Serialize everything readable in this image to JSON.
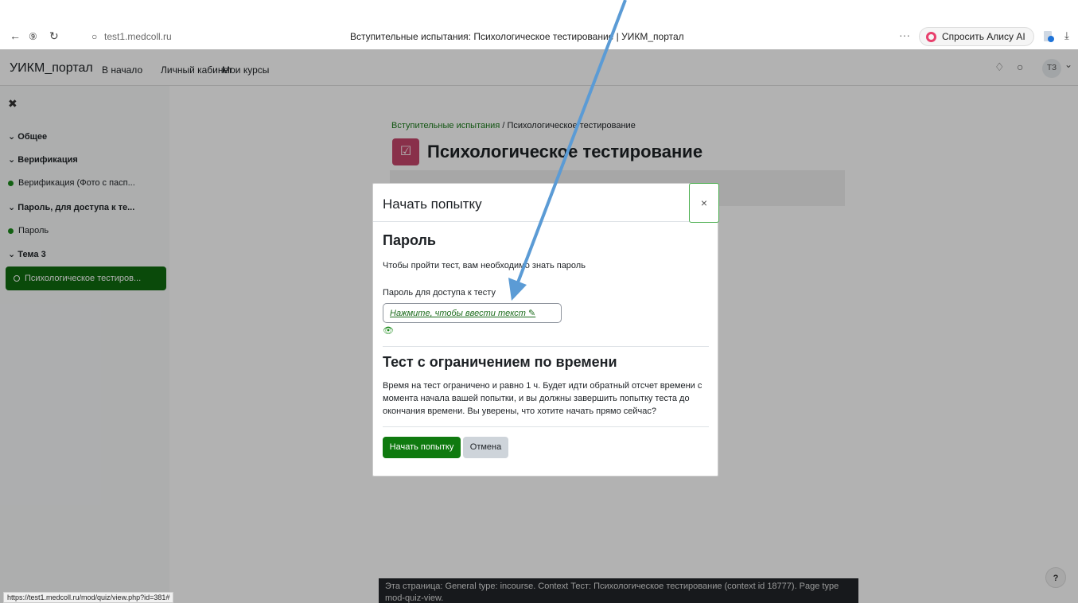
{
  "browser": {
    "back_icon": "←",
    "yandex_icon": "⑨",
    "reload_icon": "↻",
    "shield_icon": "○",
    "url": "test1.medcoll.ru",
    "tab_title": "Вступительные испытания: Психологическое тестирование | УИКМ_портал",
    "more_icon": "···",
    "alice_label": "Спросить Алису AI",
    "download_icon": "⤓"
  },
  "navbar": {
    "brand": "УИКМ_портал",
    "links": [
      "В начало",
      "Личный кабинет",
      "Мои курсы"
    ],
    "bell_icon": "♢",
    "chat_icon": "○",
    "avatar_initials": "ТЗ",
    "avatar_chevron": "⌄"
  },
  "sidebar": {
    "close_icon": "✖",
    "sections": [
      {
        "label": "Общее"
      },
      {
        "label": "Верификация"
      },
      {
        "label": "Верификация (Фото с пасп..."
      },
      {
        "label": "Пароль, для доступа к те..."
      },
      {
        "label": "Пароль"
      },
      {
        "label": "Тема 3"
      },
      {
        "label": "Психологическое тестиров..."
      }
    ],
    "chevron": "⌄"
  },
  "page": {
    "breadcrumb_link": "Вступительные испытания",
    "breadcrumb_sep": "/",
    "breadcrumb_current": "Психологическое тестирование",
    "title": "Психологическое тестирование",
    "footer_info": "Эта страница: General type: incourse. Context Тест: Психологическое тестирование (context id 18777). Page type mod-quiz-view.",
    "help_label": "?",
    "status_url": "https://test1.medcoll.ru/mod/quiz/view.php?id=381#"
  },
  "modal": {
    "title": "Начать попытку",
    "close_label": "×",
    "password_heading": "Пароль",
    "password_text": "Чтобы пройти тест, вам необходимо знать пароль",
    "password_label": "Пароль для доступа к тесту",
    "password_placeholder": "Нажмите, чтобы ввести текст ✎",
    "eye_icon": "👁",
    "time_heading": "Тест с ограничением по времени",
    "time_text": "Время на тест ограничено и равно 1 ч. Будет идти обратный отсчет времени с момента начала вашей попытки, и вы должны завершить попытку теста до окончания времени. Вы уверены, что хотите начать прямо сейчас?",
    "start_button": "Начать попытку",
    "cancel_button": "Отмена"
  },
  "colors": {
    "accent_green": "#0f7a0f",
    "quiz_icon_bg": "#c5466b",
    "annotation_arrow": "#5b9bd5"
  }
}
